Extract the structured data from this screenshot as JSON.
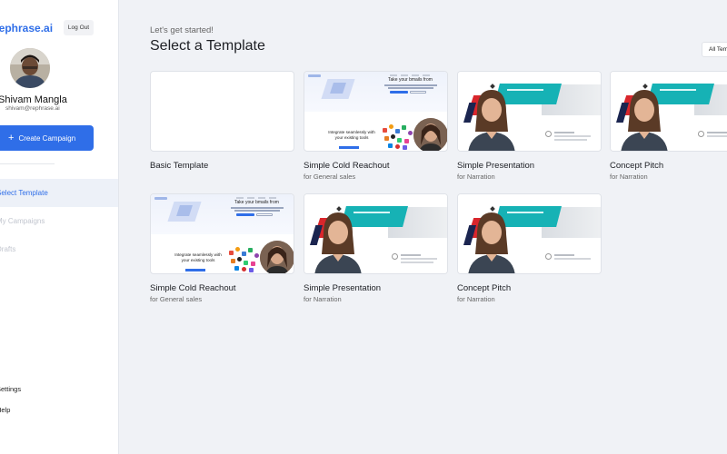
{
  "sidebar": {
    "brand": "rephrase.ai",
    "logout_label": "Log Out",
    "user": {
      "name": "Shivam Mangla",
      "email": "shivam@rephrase.ai"
    },
    "create_label": "Create Campaign",
    "nav": [
      {
        "label": "Select Template",
        "state": "active"
      },
      {
        "label": "My Campaigns",
        "state": "muted"
      },
      {
        "label": "Drafts",
        "state": "muted"
      }
    ],
    "bottom": [
      {
        "label": "Settings"
      },
      {
        "label": "Help"
      }
    ]
  },
  "main": {
    "greeting": "Let's get started!",
    "title": "Select a Template",
    "filter_label": "All Templates",
    "templates": [
      {
        "title": "Basic Template",
        "subtitle": ""
      },
      {
        "title": "Simple Cold Reachout",
        "subtitle": "for General sales",
        "preview_heading": "Take your bmails from",
        "preview_text": "Integrate seamlessly with your existing tools"
      },
      {
        "title": "Simple Presentation",
        "subtitle": "for Narration"
      },
      {
        "title": "Concept Pitch",
        "subtitle": "for Narration"
      },
      {
        "title": "Simple Cold Reachout",
        "subtitle": "for General sales",
        "preview_heading": "Take your bmails from",
        "preview_text": "Integrate seamlessly with your existing tools"
      },
      {
        "title": "Simple Presentation",
        "subtitle": "for Narration"
      },
      {
        "title": "Concept Pitch",
        "subtitle": "for Narration"
      }
    ]
  },
  "colors": {
    "accent": "#2f6ee8",
    "teal": "#16b2b5",
    "red": "#d9262c",
    "navy": "#1b2550"
  }
}
